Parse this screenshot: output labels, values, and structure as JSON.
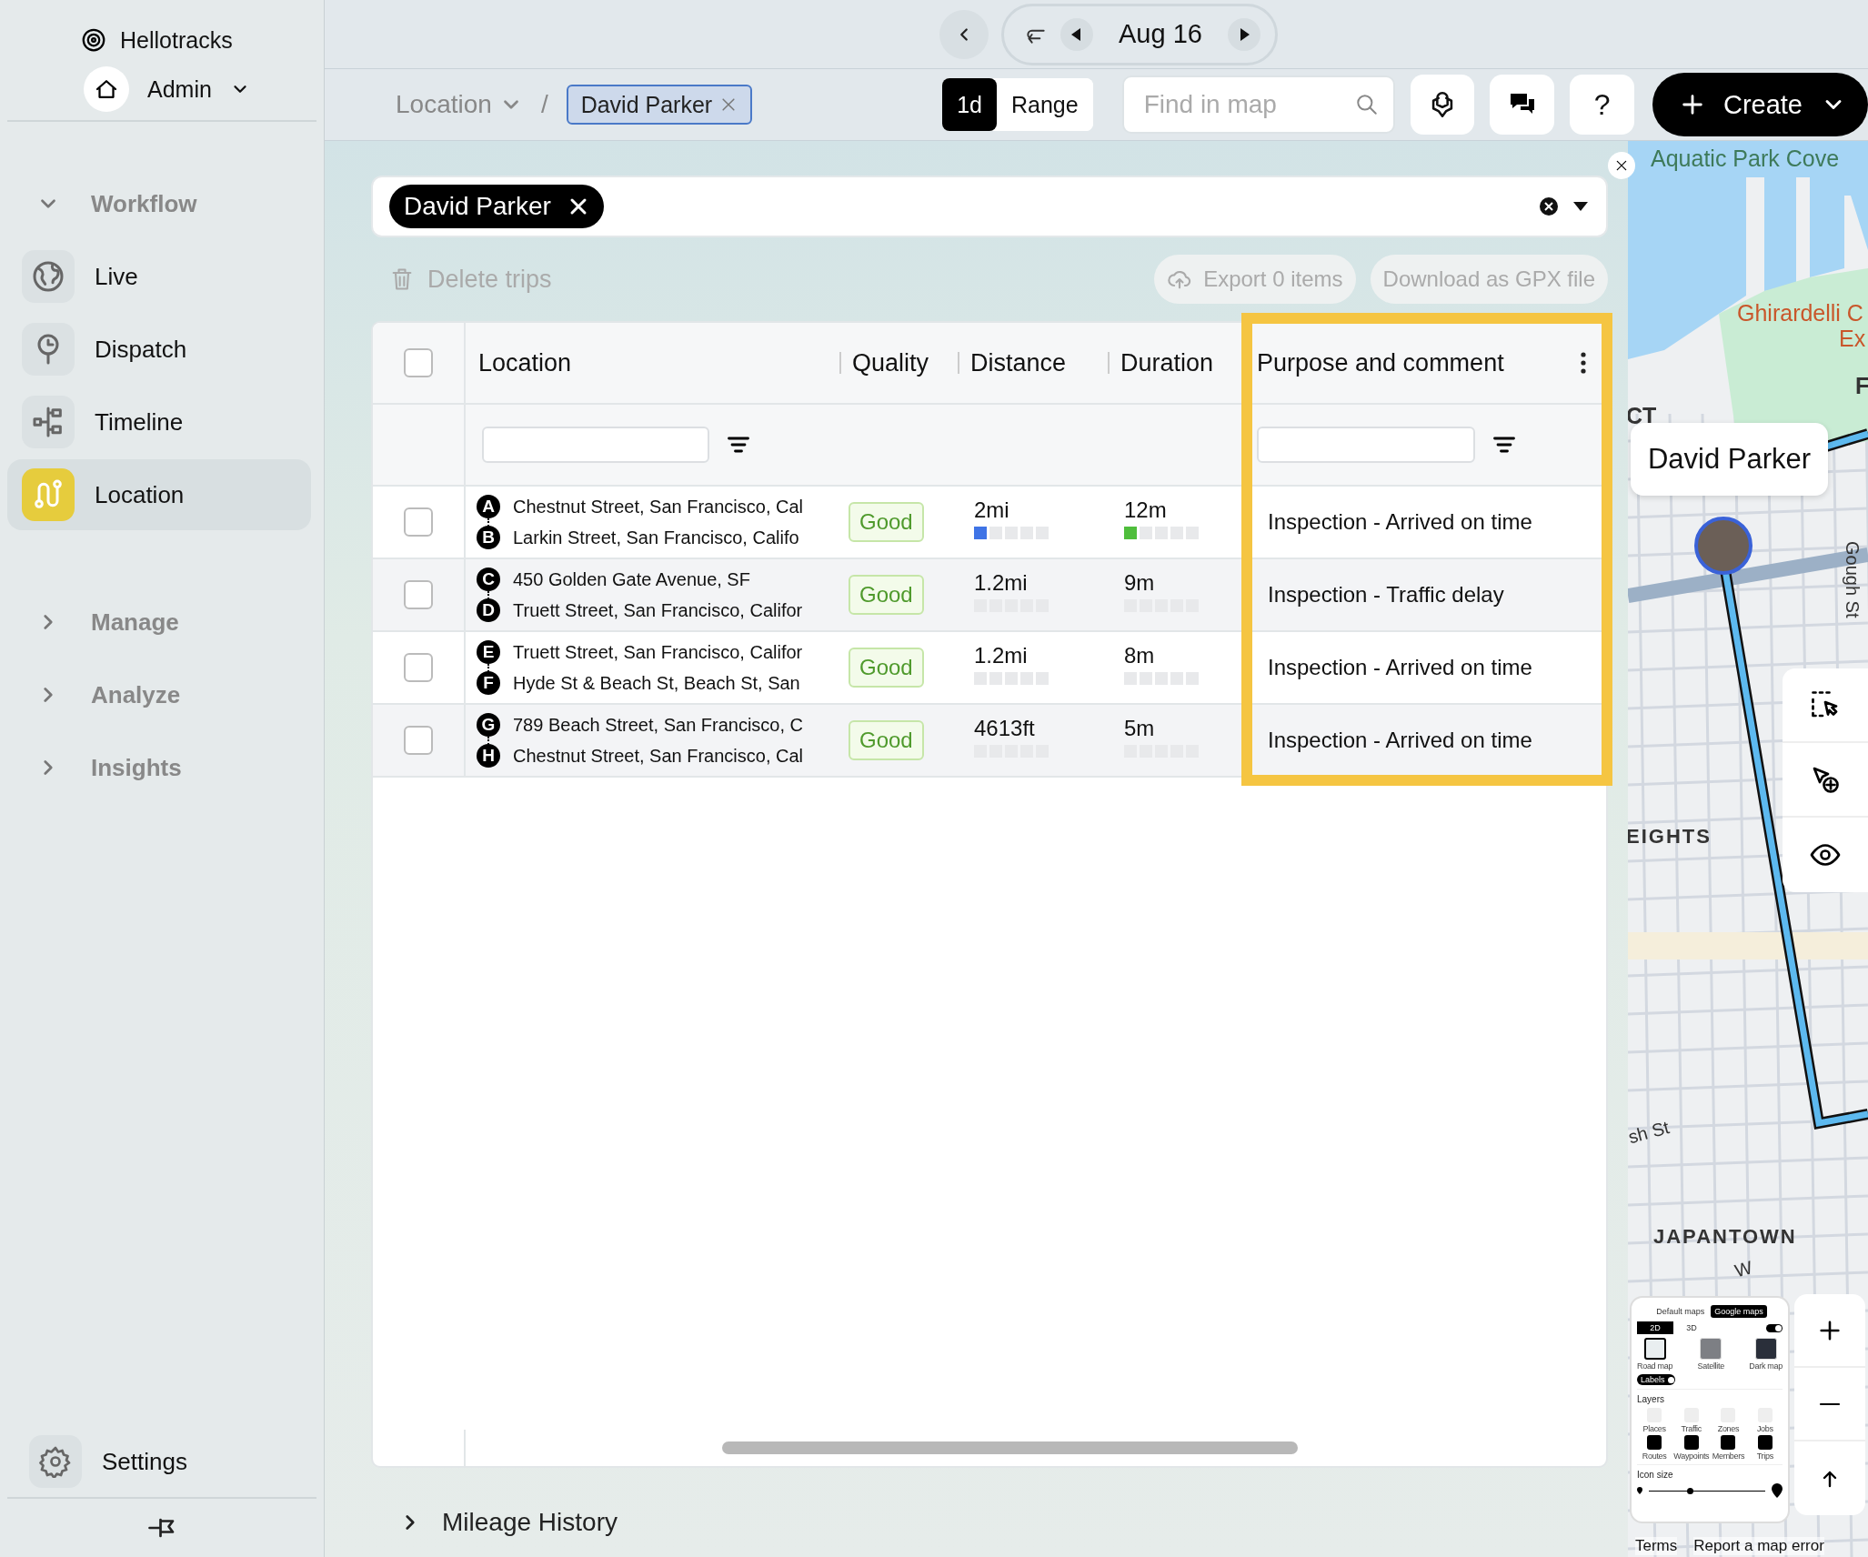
{
  "sidebar": {
    "brand": "Hellotracks",
    "account": {
      "name": "Admin"
    },
    "sections": [
      {
        "title": "Workflow",
        "expanded": true,
        "items": [
          {
            "label": "Live",
            "selected": false
          },
          {
            "label": "Dispatch",
            "selected": false
          },
          {
            "label": "Timeline",
            "selected": false
          },
          {
            "label": "Location",
            "selected": true
          }
        ]
      },
      {
        "title": "Manage",
        "expanded": false
      },
      {
        "title": "Analyze",
        "expanded": false
      },
      {
        "title": "Insights",
        "expanded": false
      }
    ],
    "settings": "Settings"
  },
  "topbar": {
    "date": "Aug 16",
    "breadcrumb": {
      "section": "Location",
      "separator": "/",
      "chip": "David Parker"
    },
    "range_toggle": [
      {
        "label": "1d",
        "selected": true
      },
      {
        "label": "Range",
        "selected": false
      }
    ],
    "search": {
      "placeholder": "Find in map"
    },
    "help": "?",
    "create": "Create"
  },
  "filter": {
    "chips": [
      "David Parker"
    ]
  },
  "actions": {
    "delete": "Delete trips",
    "export": "Export 0 items",
    "download": "Download as GPX file"
  },
  "table": {
    "select_all": {
      "checked": false
    },
    "columns": [
      "Location",
      "Quality",
      "Distance",
      "Duration",
      "Purpose and comment"
    ],
    "rows": [
      {
        "checked": false,
        "stops": [
          {
            "marker": "A",
            "address": "Chestnut Street, San Francisco, Cal"
          },
          {
            "marker": "B",
            "address": "Larkin Street, San Francisco, Califo"
          }
        ],
        "quality": "Good",
        "distance": {
          "text": "2mi",
          "level": 0.2
        },
        "duration": {
          "text": "12m",
          "level": 0.2
        },
        "purpose": "Inspection - Arrived on time"
      },
      {
        "checked": false,
        "stops": [
          {
            "marker": "C",
            "address": "450 Golden Gate Avenue, SF"
          },
          {
            "marker": "D",
            "address": "Truett Street, San Francisco, Califor"
          }
        ],
        "quality": "Good",
        "distance": {
          "text": "1.2mi",
          "level": 0
        },
        "duration": {
          "text": "9m",
          "level": 0
        },
        "purpose": "Inspection - Traffic delay"
      },
      {
        "checked": false,
        "stops": [
          {
            "marker": "E",
            "address": "Truett Street, San Francisco, Califor"
          },
          {
            "marker": "F",
            "address": "Hyde St & Beach St, Beach St, San"
          }
        ],
        "quality": "Good",
        "distance": {
          "text": "1.2mi",
          "level": 0
        },
        "duration": {
          "text": "8m",
          "level": 0
        },
        "purpose": "Inspection - Arrived on time"
      },
      {
        "checked": false,
        "stops": [
          {
            "marker": "G",
            "address": "789 Beach Street, San Francisco, C"
          },
          {
            "marker": "H",
            "address": "Chestnut Street, San Francisco, Cal"
          }
        ],
        "quality": "Good",
        "distance": {
          "text": "4613ft",
          "level": 0
        },
        "duration": {
          "text": "5m",
          "level": 0
        },
        "purpose": "Inspection - Arrived on time"
      }
    ]
  },
  "footer": {
    "title": "Mileage History",
    "expanded": false
  },
  "map": {
    "labels": [
      {
        "text": "Aquatic Park Cove",
        "kind": "water"
      },
      {
        "text": "Ghirardelli C",
        "kind": "poi"
      },
      {
        "text": "Ex",
        "kind": "poi"
      },
      {
        "text": "F",
        "kind": "area"
      },
      {
        "text": "CT",
        "kind": "area"
      },
      {
        "text": "EIGHTS",
        "kind": "district"
      },
      {
        "text": "Gough St",
        "kind": "street"
      },
      {
        "text": "sh St",
        "kind": "street"
      },
      {
        "text": "JAPANTOWN",
        "kind": "district"
      },
      {
        "text": "W",
        "kind": "street"
      }
    ],
    "marker": {
      "name": "David Parker"
    },
    "layers_panel": {
      "sources": [
        {
          "label": "Default maps",
          "selected": false
        },
        {
          "label": "Google maps",
          "selected": true
        }
      ],
      "modes": [
        {
          "label": "2D",
          "selected": true
        },
        {
          "label": "3D",
          "selected": false
        }
      ],
      "switch_on": true,
      "styles": [
        {
          "label": "Road map",
          "selected": true
        },
        {
          "label": "Satellite",
          "selected": false
        },
        {
          "label": "Dark map",
          "selected": false
        }
      ],
      "labels_toggle": {
        "label": "Labels",
        "on": true
      },
      "layers_title": "Layers",
      "layers": [
        {
          "label": "Places",
          "on": false
        },
        {
          "label": "Traffic",
          "on": false
        },
        {
          "label": "Zones",
          "on": false
        },
        {
          "label": "Jobs",
          "on": false
        },
        {
          "label": "Routes",
          "on": true
        },
        {
          "label": "Waypoints",
          "on": true
        },
        {
          "label": "Members",
          "on": true
        },
        {
          "label": "Trips",
          "on": true
        }
      ],
      "icon_size": {
        "label": "Icon size",
        "level": 0.35
      }
    },
    "footer": [
      "Terms",
      "Report a map error"
    ]
  }
}
